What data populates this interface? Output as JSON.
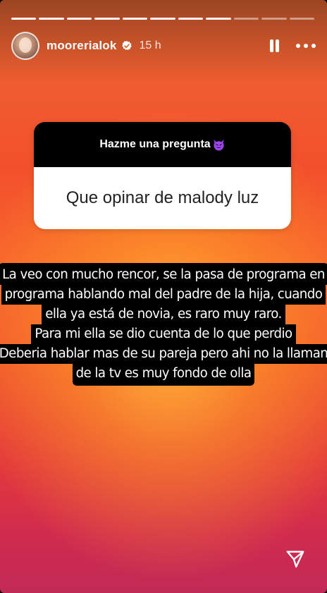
{
  "story": {
    "username": "moorerialok",
    "time": "15 h",
    "segments_total": 11,
    "segments_viewed": 8
  },
  "question_box": {
    "prompt": "Hazme una pregunta",
    "prompt_emoji": "smiling-face-with-horns",
    "question": "Que opinar de malody luz"
  },
  "answer": {
    "lines": [
      "La veo con mucho rencor, se la pasa de programa en",
      "programa hablando mal del padre de la hija, cuando",
      "ella ya está de novia, es raro muy raro.",
      "Para mi ella se dio cuenta de lo que perdio",
      "Deberia  hablar mas de su pareja pero ahi no la llaman",
      "de la tv es muy fondo de olla"
    ]
  },
  "icons": {
    "verified": "verified-badge-icon",
    "pause": "pause-icon",
    "more": "more-options-icon",
    "share": "send-icon"
  },
  "colors": {
    "gradient_top": "#ee6a34",
    "gradient_middle": "#ffb13a",
    "gradient_bottom": "#c12a56"
  }
}
